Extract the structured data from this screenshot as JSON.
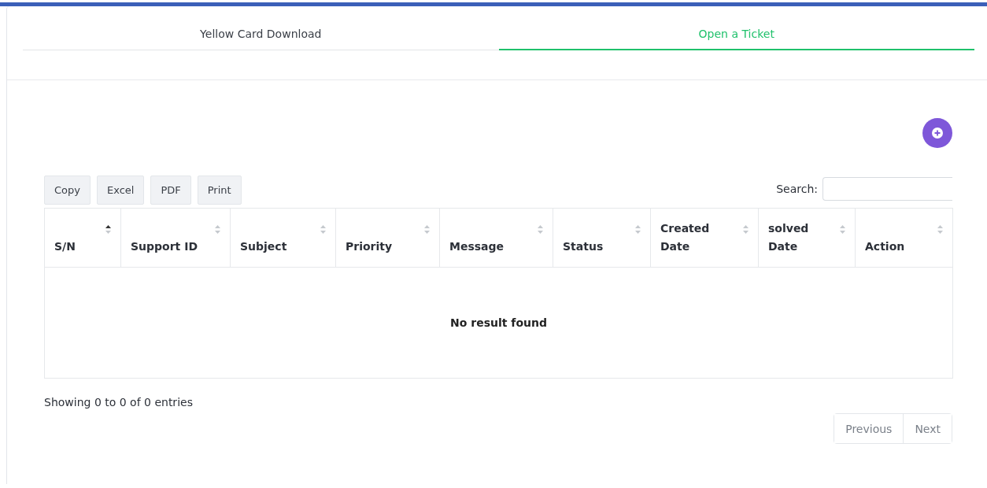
{
  "tabs": [
    {
      "label": "Yellow Card Download",
      "selected": false
    },
    {
      "label": "Open a Ticket",
      "selected": true
    }
  ],
  "export_buttons": [
    "Copy",
    "Excel",
    "PDF",
    "Print"
  ],
  "search": {
    "label": "Search:"
  },
  "table": {
    "columns": [
      {
        "label": "S/N",
        "sorted": true
      },
      {
        "label": "Support ID",
        "sorted": false
      },
      {
        "label": "Subject",
        "sorted": false
      },
      {
        "label": "Priority",
        "sorted": false
      },
      {
        "label": "Message",
        "sorted": false
      },
      {
        "label": "Status",
        "sorted": false
      },
      {
        "label": "Created Date",
        "sorted": false
      },
      {
        "label": "solved Date",
        "sorted": false
      },
      {
        "label": "Action",
        "sorted": false
      }
    ],
    "empty_message": "No result found"
  },
  "info": "Showing 0 to 0 of 0 entries",
  "pagination": {
    "previous": {
      "label": "Previous",
      "disabled": true
    },
    "next": {
      "label": "Next",
      "disabled": true
    }
  }
}
